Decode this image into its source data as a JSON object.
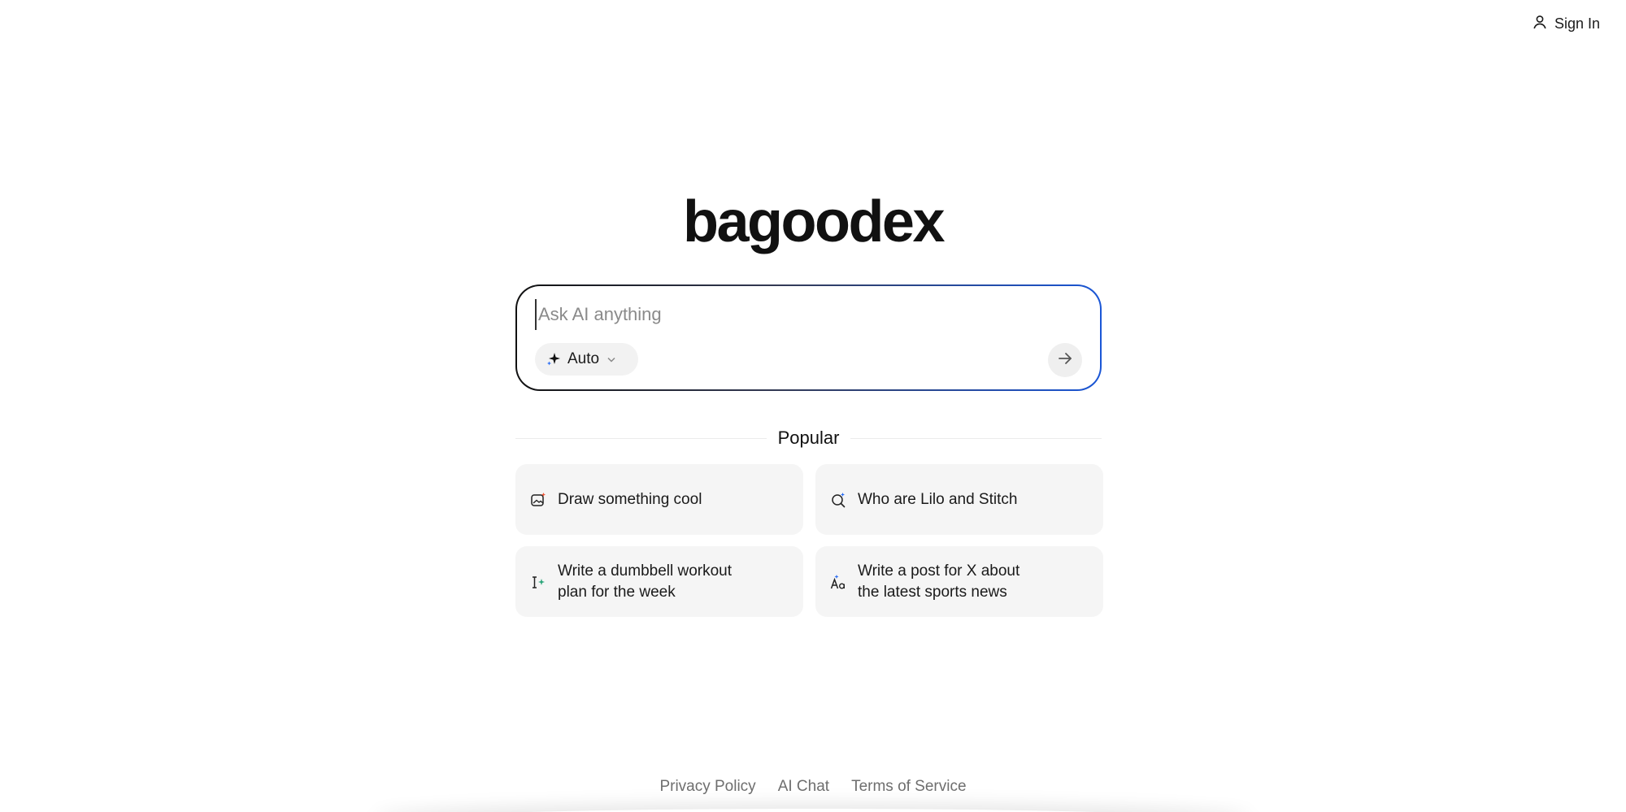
{
  "header": {
    "signin_label": "Sign In",
    "signin_icon": "user-icon"
  },
  "logo": {
    "text": "bagoodex"
  },
  "search": {
    "placeholder": "Ask AI anything",
    "value": "",
    "mode_label": "Auto",
    "mode_icon": "sparkle-icon",
    "send_icon": "arrow-right-icon",
    "border_gradient": [
      "#111111",
      "#1a56d6"
    ]
  },
  "popular": {
    "heading": "Popular",
    "items": [
      {
        "label": "Draw something cool",
        "icon": "image-sparkle-icon"
      },
      {
        "label": "Who are Lilo and Stitch",
        "icon": "search-sparkle-icon"
      },
      {
        "label": "Write a dumbbell workout\nplan for the week",
        "icon": "text-cursor-sparkle-icon"
      },
      {
        "label": "Write a post for X about\nthe latest sports news",
        "icon": "font-sparkle-icon"
      }
    ]
  },
  "footer": {
    "links": [
      {
        "label": "Privacy Policy"
      },
      {
        "label": "AI Chat"
      },
      {
        "label": "Terms of Service"
      }
    ]
  }
}
